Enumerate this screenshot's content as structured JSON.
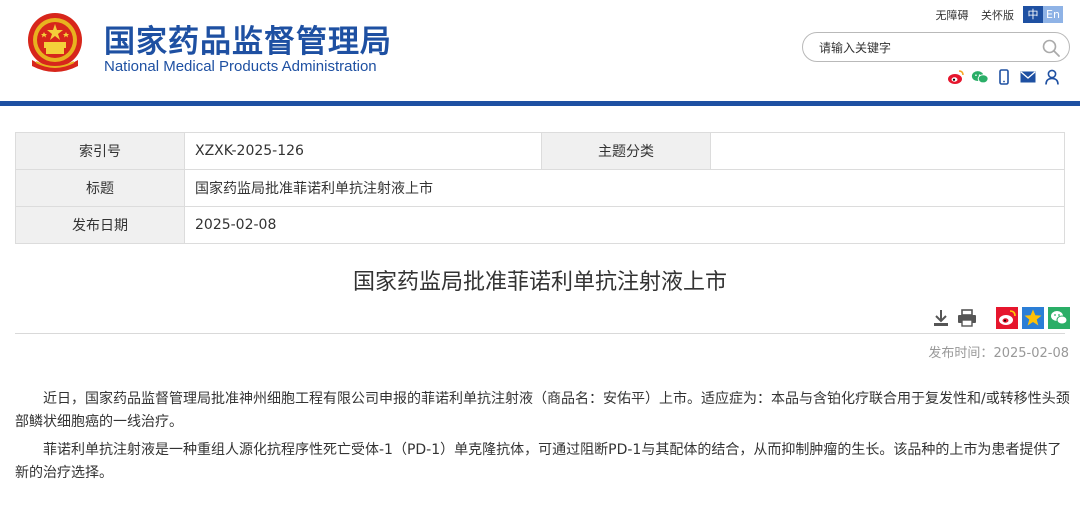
{
  "header": {
    "site_name_cn": "国家药品监督管理局",
    "site_name_en": "National Medical Products Administration",
    "top_links": [
      "无障碍",
      "关怀版"
    ],
    "lang": {
      "zh": "中",
      "en": "En"
    },
    "search_placeholder": "请输入关键字",
    "social_icons": [
      "weibo-icon",
      "wechat-icon",
      "mobile-icon",
      "email-icon",
      "user-icon"
    ]
  },
  "info_table": {
    "index_label": "索引号",
    "index_value": "XZXK-2025-126",
    "topic_label": "主题分类",
    "topic_value": "",
    "title_label": "标题",
    "title_value": "国家药监局批准菲诺利单抗注射液上市",
    "date_label": "发布日期",
    "date_value": "2025-02-08"
  },
  "article": {
    "title": "国家药监局批准菲诺利单抗注射液上市",
    "publish_label": "发布时间：",
    "publish_date": "2025-02-08",
    "paragraphs": [
      "近日，国家药品监督管理局批准神州细胞工程有限公司申报的菲诺利单抗注射液（商品名：安佑平）上市。适应症为：本品与含铂化疗联合用于复发性和/或转移性头颈部鳞状细胞癌的一线治疗。",
      "菲诺利单抗注射液是一种重组人源化抗程序性死亡受体-1（PD-1）单克隆抗体，可通过阻断PD-1与其配体的结合，从而抑制肿瘤的生长。该品种的上市为患者提供了新的治疗选择。"
    ],
    "tool_icons": [
      "download-icon",
      "print-icon",
      "weibo-share-icon",
      "qzone-share-icon",
      "wechat-share-icon"
    ]
  },
  "colors": {
    "brand_blue": "#1e50a2",
    "label_bg": "#f0f0f0"
  }
}
